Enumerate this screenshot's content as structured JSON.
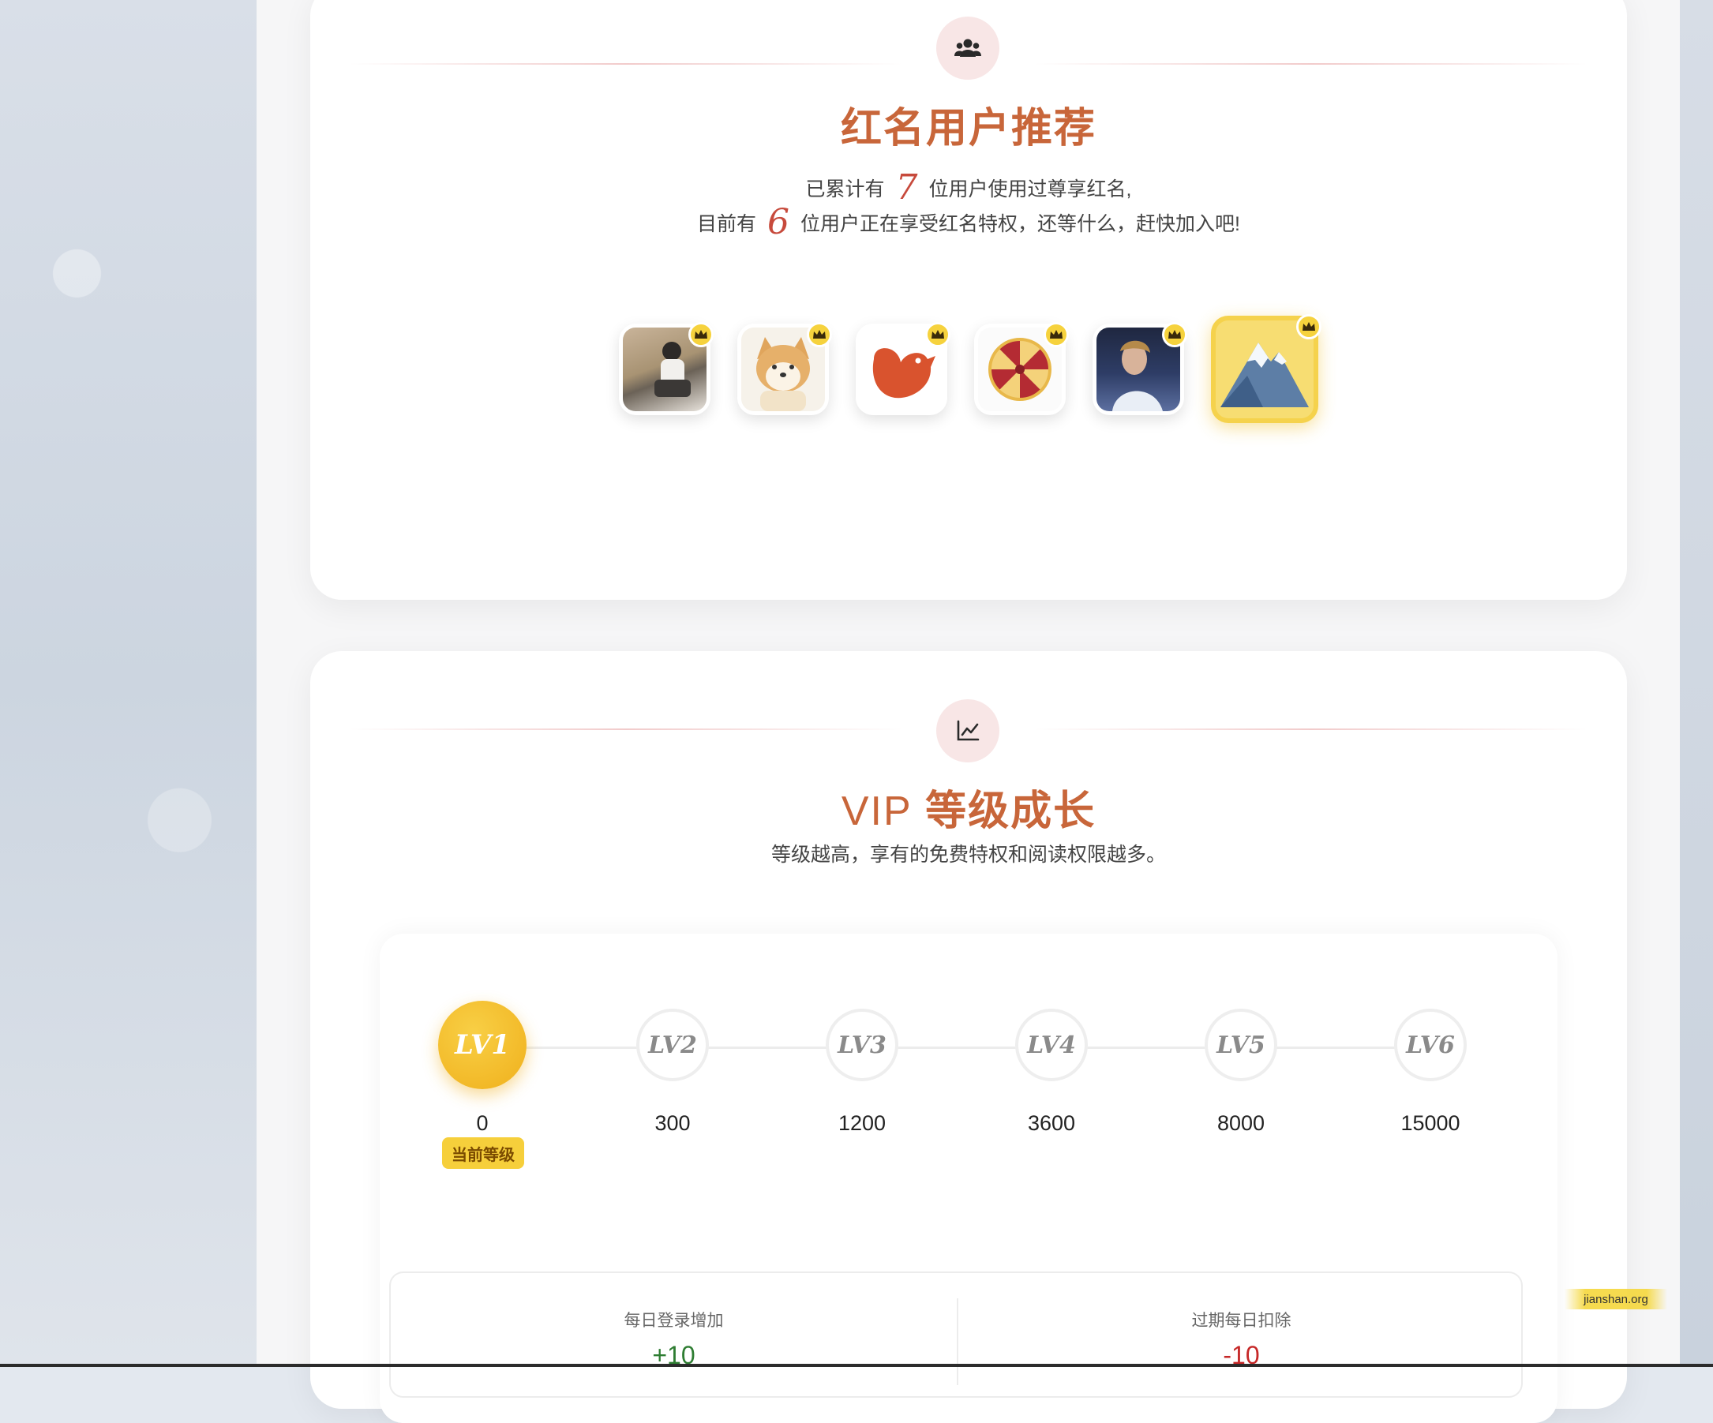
{
  "red_users": {
    "title": "红名用户推荐",
    "line1_prefix": "已累计有",
    "line1_count": "7",
    "line1_suffix": "位用户使用过尊享红名,",
    "line2_prefix": "目前有",
    "line2_count": "6",
    "line2_suffix": "位用户正在享受红名特权，还等什么，赶快加入吧!",
    "avatars": [
      {
        "name": "user-avatar-1"
      },
      {
        "name": "user-avatar-2"
      },
      {
        "name": "user-avatar-3"
      },
      {
        "name": "user-avatar-4"
      },
      {
        "name": "user-avatar-5"
      },
      {
        "name": "user-avatar-6"
      }
    ],
    "icon": "users-icon"
  },
  "vip": {
    "title_prefix": "VIP",
    "title_main": "等级成长",
    "subtitle": "等级越高，享有的免费特权和阅读权限越多。",
    "icon": "chart-line-icon",
    "current_level_label": "当前等级",
    "levels": [
      {
        "label": "LV1",
        "points": "0"
      },
      {
        "label": "LV2",
        "points": "300"
      },
      {
        "label": "LV3",
        "points": "1200"
      },
      {
        "label": "LV4",
        "points": "3600"
      },
      {
        "label": "LV5",
        "points": "8000"
      },
      {
        "label": "LV6",
        "points": "15000"
      }
    ],
    "stats": {
      "daily_login_label": "每日登录增加",
      "daily_login_value": "+10",
      "expired_label": "过期每日扣除",
      "expired_value": "-10"
    }
  },
  "watermark": "jianshan.org",
  "colors": {
    "accent": "#c8663a",
    "number_red": "#c74a3c",
    "gold": "#f0b01c",
    "positive": "#2e7d32",
    "negative": "#c62828"
  }
}
